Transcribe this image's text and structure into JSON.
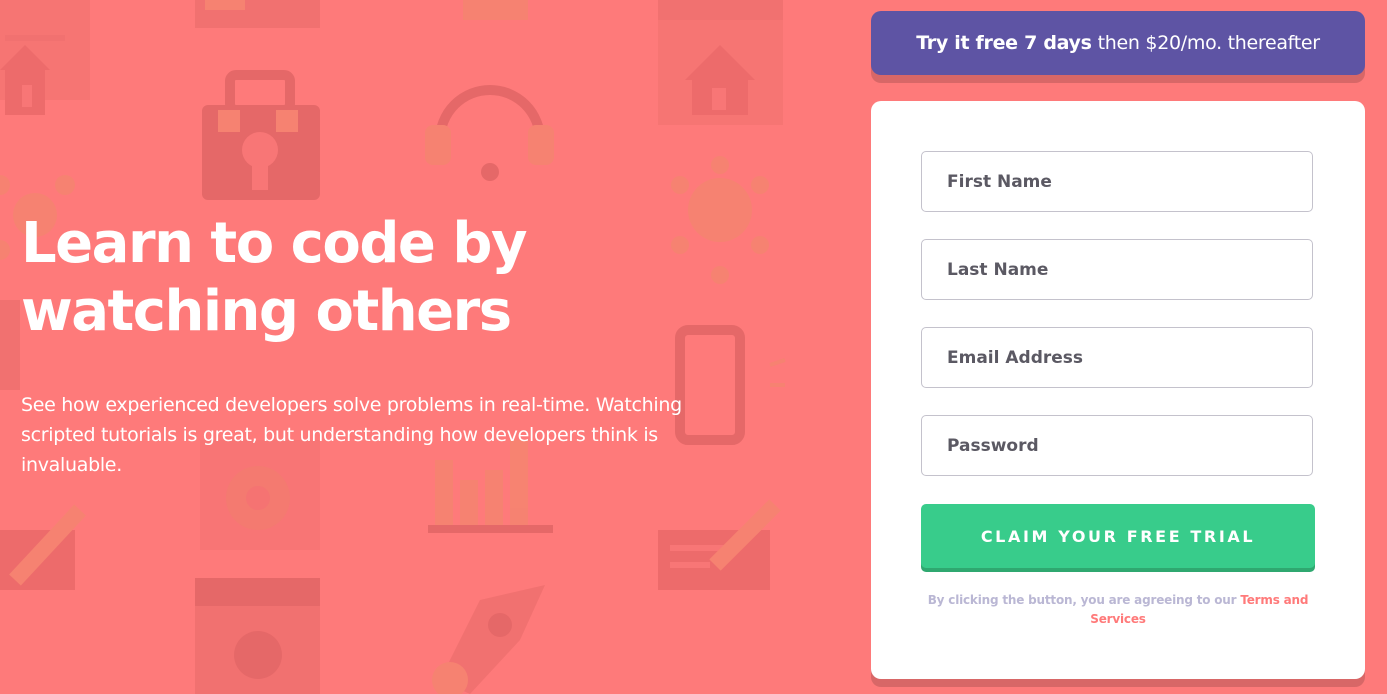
{
  "hero": {
    "title_line1": "Learn to code by",
    "title_line2": "watching others",
    "description": "See how experienced developers solve problems in real-time. Watching scripted tutorials is great, but understanding how developers think is invaluable."
  },
  "promo": {
    "bold": "Try it free 7 days",
    "rest": "then $20/mo. thereafter"
  },
  "form": {
    "first_name_placeholder": "First Name",
    "last_name_placeholder": "Last Name",
    "email_placeholder": "Email Address",
    "password_placeholder": "Password",
    "submit_label": "CLAIM YOUR FREE TRIAL",
    "terms_text": "By clicking the button, you are agreeing to our ",
    "terms_link": "Terms and Services"
  },
  "colors": {
    "background": "#fe7a7a",
    "promo": "#5e54a4",
    "button": "#38cc8b",
    "terms_link": "#ff7a7a",
    "terms_text": "#bab7d4"
  },
  "background_icons": [
    "browser-icon",
    "house-icon",
    "toolbox-icon",
    "headset-icon",
    "network-icon",
    "gear-icon",
    "bar-chart-icon",
    "pencil-icon",
    "magnifier-icon",
    "rocket-icon",
    "phone-icon"
  ]
}
